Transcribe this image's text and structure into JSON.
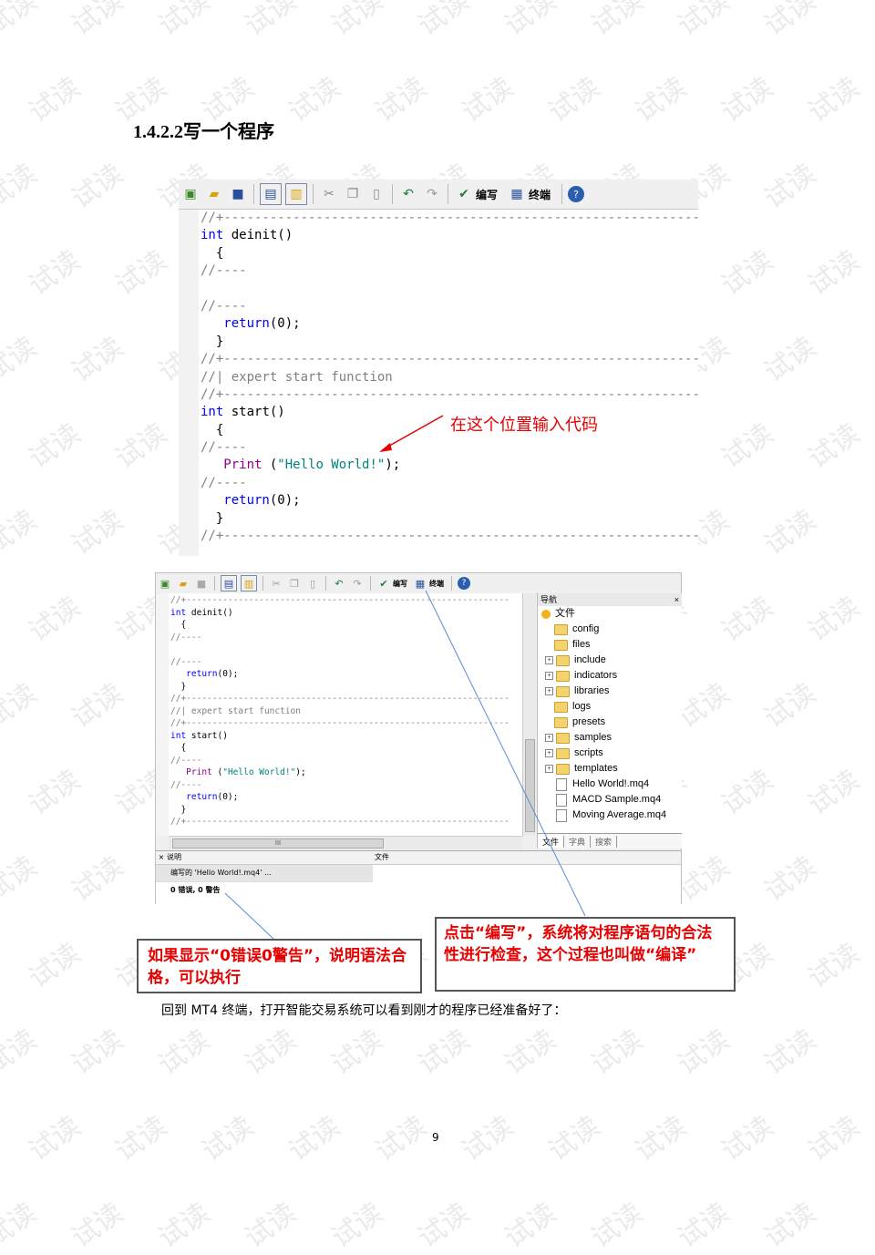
{
  "watermark": "试读",
  "heading": {
    "num": "1.4.2.2",
    "text": "写一个程序"
  },
  "toolbar1": {
    "compile_label": "编写",
    "terminal_label": "终端"
  },
  "code_lines": [
    {
      "parts": [
        [
          "cm",
          "//+--------------------------------------------------------------"
        ]
      ]
    },
    {
      "parts": [
        [
          "kw",
          "int"
        ],
        [
          "fn",
          " deinit()"
        ]
      ]
    },
    {
      "parts": [
        [
          "fn",
          "  {"
        ]
      ]
    },
    {
      "parts": [
        [
          "cm",
          "//----"
        ]
      ]
    },
    {
      "parts": [
        [
          "fn",
          ""
        ]
      ]
    },
    {
      "parts": [
        [
          "cm",
          "//----"
        ]
      ]
    },
    {
      "parts": [
        [
          "kw",
          "   return"
        ],
        [
          "fn",
          "(0);"
        ]
      ]
    },
    {
      "parts": [
        [
          "fn",
          "  }"
        ]
      ]
    },
    {
      "parts": [
        [
          "cm",
          "//+--------------------------------------------------------------"
        ]
      ]
    },
    {
      "parts": [
        [
          "cm",
          "//| expert start function"
        ]
      ]
    },
    {
      "parts": [
        [
          "cm",
          "//+--------------------------------------------------------------"
        ]
      ]
    },
    {
      "parts": [
        [
          "kw",
          "int"
        ],
        [
          "fn",
          " start()"
        ]
      ]
    },
    {
      "parts": [
        [
          "fn",
          "  {"
        ]
      ]
    },
    {
      "parts": [
        [
          "cm",
          "//----"
        ]
      ]
    },
    {
      "parts": [
        [
          "fnc",
          "   Print"
        ],
        [
          "fn",
          " ("
        ],
        [
          "str",
          "\"Hello World!\""
        ],
        [
          "fn",
          ");"
        ]
      ]
    },
    {
      "parts": [
        [
          "cm",
          "//----"
        ]
      ]
    },
    {
      "parts": [
        [
          "kw",
          "   return"
        ],
        [
          "fn",
          "(0);"
        ]
      ]
    },
    {
      "parts": [
        [
          "fn",
          "  }"
        ]
      ]
    },
    {
      "parts": [
        [
          "cm",
          "//+--------------------------------------------------------------"
        ]
      ]
    }
  ],
  "annotation_top": "在这个位置输入代码",
  "toolbar2": {
    "compile_label": "编写",
    "terminal_label": "终端",
    "tooltip": "编写"
  },
  "navigator": {
    "title": "导航",
    "root": "文件",
    "folders": [
      "config",
      "files",
      "include",
      "indicators",
      "libraries",
      "logs",
      "presets",
      "samples",
      "scripts",
      "templates"
    ],
    "expandable": [
      false,
      false,
      true,
      true,
      true,
      false,
      false,
      true,
      true,
      true
    ],
    "files": [
      "Hello World!.mq4",
      "MACD Sample.mq4",
      "Moving Average.mq4"
    ],
    "tabs": [
      "文件",
      "字典",
      "搜索"
    ]
  },
  "hscroll_mark": "III",
  "output": {
    "col_desc": "说明",
    "col_file": "文件",
    "row1": "编写的 'Hello World!.mq4' ...",
    "row2": "0 错误, 0 警告"
  },
  "callout_left": "如果显示“0错误0警告”，说明语法合格，可以执行",
  "callout_right": "点击“编写”，系统将对程序语句的合法性进行检查，这个过程也叫做“编译”",
  "body_text": "回到 MT4 终端，打开智能交易系统可以看到刚才的程序已经准备好了：",
  "page_number": "9"
}
